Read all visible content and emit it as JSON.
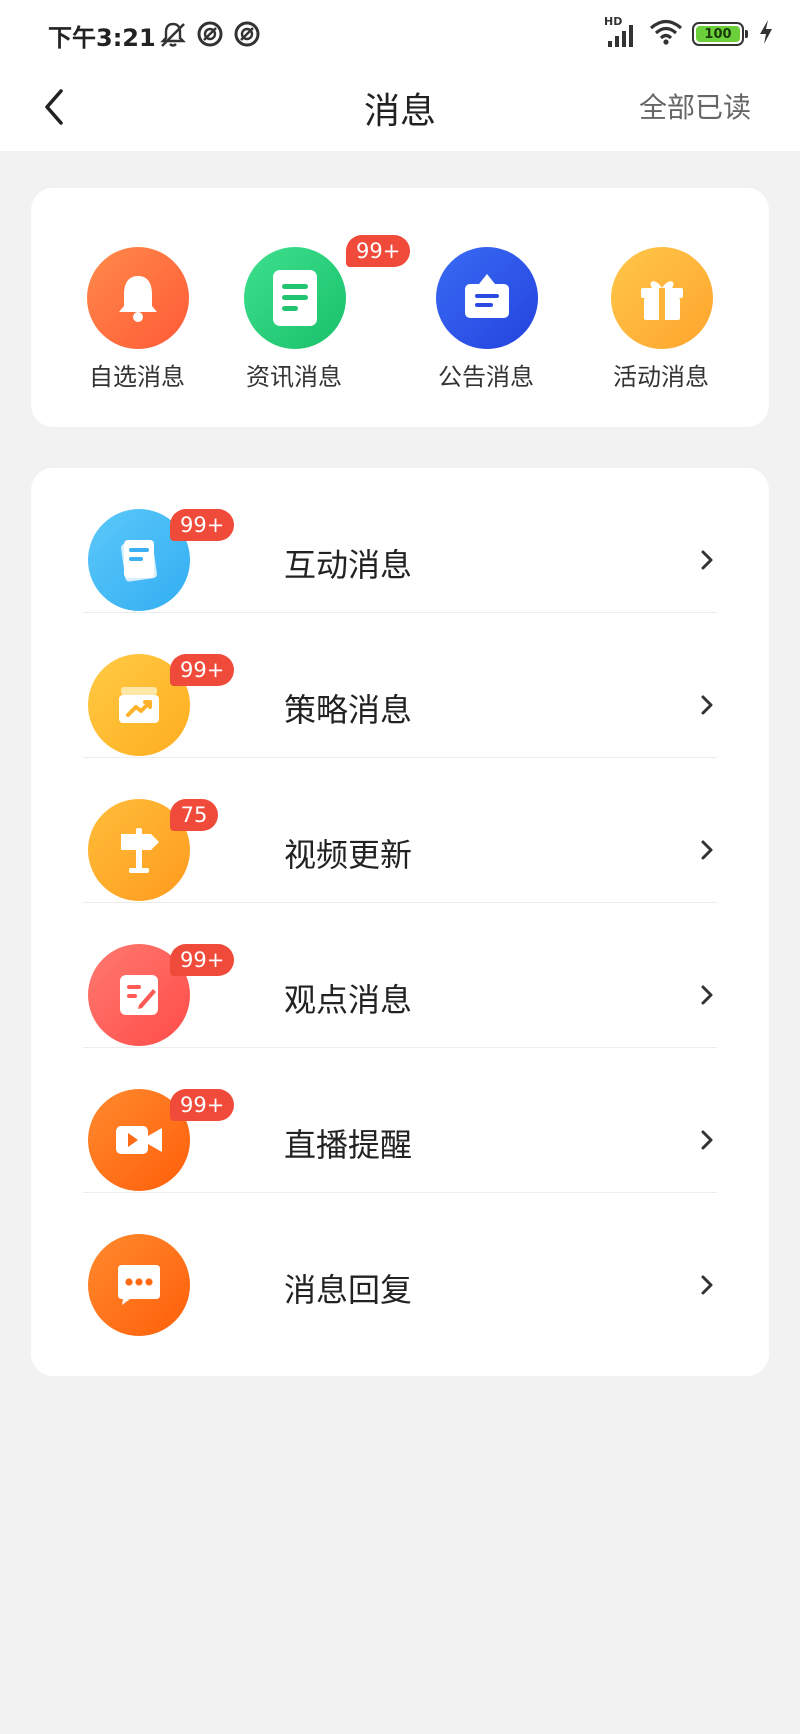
{
  "status_bar": {
    "time": "下午3:21",
    "battery": "100",
    "network": "HD"
  },
  "header": {
    "title": "消息",
    "mark_all_read": "全部已读"
  },
  "categories": [
    {
      "label": "自选消息",
      "icon": "bell-icon",
      "color": "#ff6a3d",
      "badge": ""
    },
    {
      "label": "资讯消息",
      "icon": "document-icon",
      "color": "#22cc78",
      "badge": "99+"
    },
    {
      "label": "公告消息",
      "icon": "notice-board-icon",
      "color": "#2f56e8",
      "badge": ""
    },
    {
      "label": "活动消息",
      "icon": "gift-icon",
      "color": "#ffb73a",
      "badge": ""
    }
  ],
  "list": [
    {
      "label": "互动消息",
      "icon": "cards-icon",
      "color": "#3bb5f5",
      "badge": "99+"
    },
    {
      "label": "策略消息",
      "icon": "chart-box-icon",
      "color": "#ffb92e",
      "badge": "99+"
    },
    {
      "label": "视频更新",
      "icon": "signpost-icon",
      "color": "#ffa826",
      "badge": "75"
    },
    {
      "label": "观点消息",
      "icon": "edit-note-icon",
      "color": "#ff5a55",
      "badge": "99+"
    },
    {
      "label": "直播提醒",
      "icon": "video-camera-icon",
      "color": "#ff6a14",
      "badge": "99+"
    },
    {
      "label": "消息回复",
      "icon": "chat-bubble-icon",
      "color": "#ff6a14",
      "badge": ""
    }
  ]
}
